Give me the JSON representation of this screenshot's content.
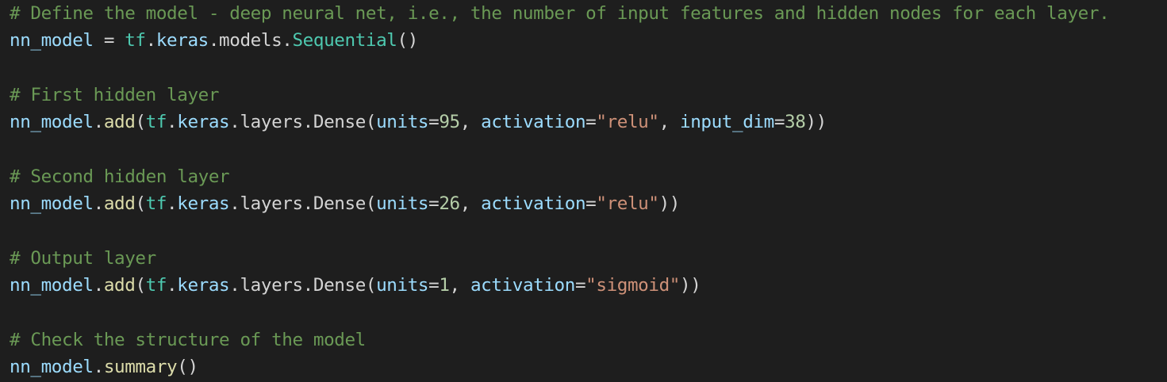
{
  "editor": {
    "theme": {
      "background": "#1e1e1e",
      "comment": "#6a9955",
      "variable": "#9cdcfe",
      "module": "#4ec9b0",
      "function": "#dcdcaa",
      "number": "#b5cea8",
      "string": "#ce9178",
      "text": "#d4d4d4"
    },
    "lines": [
      {
        "tokens": [
          [
            "c",
            "# Define the model - deep neural net, i.e., the number of input features and hidden nodes for each layer."
          ]
        ]
      },
      {
        "tokens": [
          [
            "v",
            "nn_model"
          ],
          [
            "p",
            " = "
          ],
          [
            "m",
            "tf"
          ],
          [
            "p",
            "."
          ],
          [
            "v",
            "keras"
          ],
          [
            "p",
            ".models."
          ],
          [
            "m",
            "Sequential"
          ],
          [
            "p",
            "()"
          ]
        ]
      },
      {
        "tokens": []
      },
      {
        "tokens": [
          [
            "c",
            "# First hidden layer"
          ]
        ]
      },
      {
        "tokens": [
          [
            "v",
            "nn_model"
          ],
          [
            "p",
            "."
          ],
          [
            "f",
            "add"
          ],
          [
            "p",
            "("
          ],
          [
            "m",
            "tf"
          ],
          [
            "p",
            "."
          ],
          [
            "v",
            "keras"
          ],
          [
            "p",
            ".layers.Dense("
          ],
          [
            "v",
            "units"
          ],
          [
            "p",
            "="
          ],
          [
            "n",
            "95"
          ],
          [
            "p",
            ", "
          ],
          [
            "v",
            "activation"
          ],
          [
            "p",
            "="
          ],
          [
            "s",
            "\"relu\""
          ],
          [
            "p",
            ", "
          ],
          [
            "v",
            "input_dim"
          ],
          [
            "p",
            "="
          ],
          [
            "n",
            "38"
          ],
          [
            "p",
            "))"
          ]
        ]
      },
      {
        "tokens": []
      },
      {
        "tokens": [
          [
            "c",
            "# Second hidden layer"
          ]
        ]
      },
      {
        "tokens": [
          [
            "v",
            "nn_model"
          ],
          [
            "p",
            "."
          ],
          [
            "f",
            "add"
          ],
          [
            "p",
            "("
          ],
          [
            "m",
            "tf"
          ],
          [
            "p",
            "."
          ],
          [
            "v",
            "keras"
          ],
          [
            "p",
            ".layers.Dense("
          ],
          [
            "v",
            "units"
          ],
          [
            "p",
            "="
          ],
          [
            "n",
            "26"
          ],
          [
            "p",
            ", "
          ],
          [
            "v",
            "activation"
          ],
          [
            "p",
            "="
          ],
          [
            "s",
            "\"relu\""
          ],
          [
            "p",
            "))"
          ]
        ]
      },
      {
        "tokens": []
      },
      {
        "tokens": [
          [
            "c",
            "# Output layer"
          ]
        ]
      },
      {
        "tokens": [
          [
            "v",
            "nn_model"
          ],
          [
            "p",
            "."
          ],
          [
            "f",
            "add"
          ],
          [
            "p",
            "("
          ],
          [
            "m",
            "tf"
          ],
          [
            "p",
            "."
          ],
          [
            "v",
            "keras"
          ],
          [
            "p",
            ".layers.Dense("
          ],
          [
            "v",
            "units"
          ],
          [
            "p",
            "="
          ],
          [
            "n",
            "1"
          ],
          [
            "p",
            ", "
          ],
          [
            "v",
            "activation"
          ],
          [
            "p",
            "="
          ],
          [
            "s",
            "\"sigmoid\""
          ],
          [
            "p",
            "))"
          ]
        ]
      },
      {
        "tokens": []
      },
      {
        "tokens": [
          [
            "c",
            "# Check the structure of the model"
          ]
        ]
      },
      {
        "tokens": [
          [
            "v",
            "nn_model"
          ],
          [
            "p",
            "."
          ],
          [
            "f",
            "summary"
          ],
          [
            "p",
            "()"
          ]
        ]
      }
    ]
  }
}
